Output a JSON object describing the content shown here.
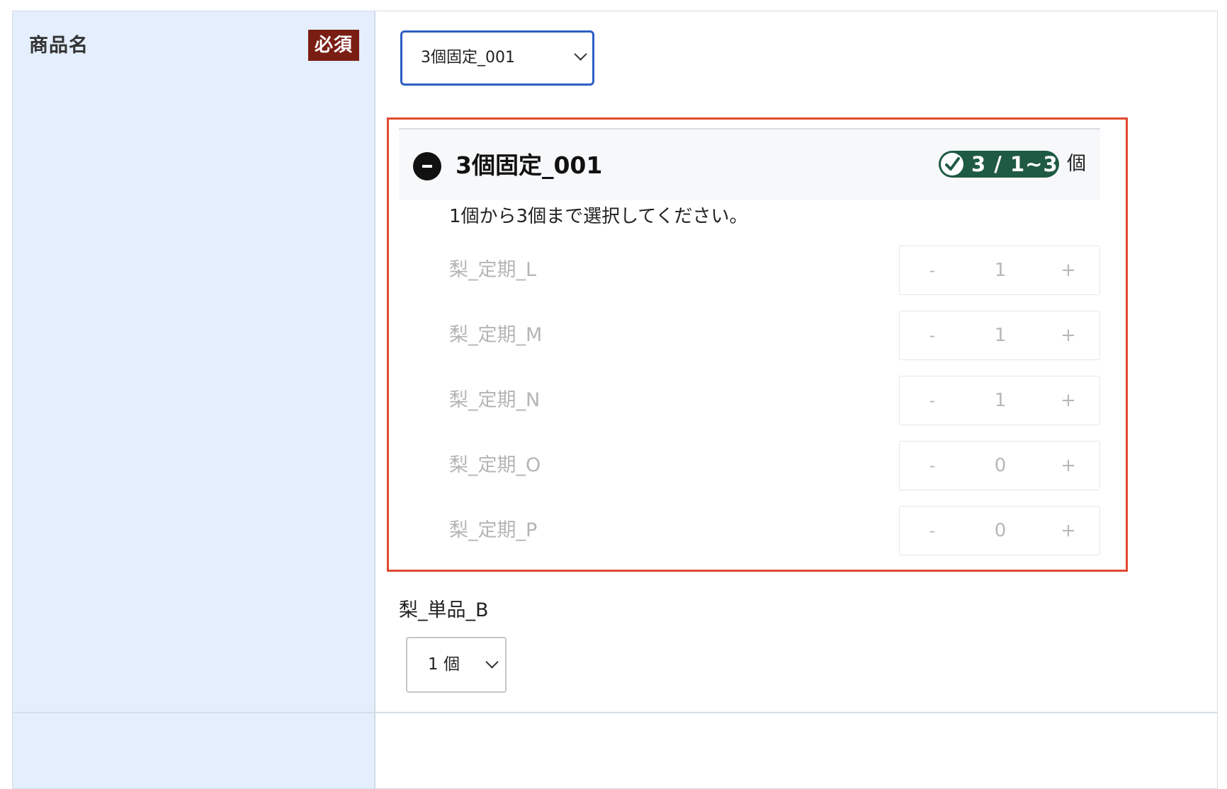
{
  "field": {
    "label": "商品名",
    "required_badge": "必須"
  },
  "product_select": {
    "selected": "3個固定_001"
  },
  "group": {
    "title": "3個固定_001",
    "count_badge": "3 / 1~3",
    "unit": "個",
    "instruction": "1個から3個まで選択してください。",
    "items": [
      {
        "name": "梨_定期_L",
        "quantity": "1",
        "minus": "-",
        "plus": "+"
      },
      {
        "name": "梨_定期_M",
        "quantity": "1",
        "minus": "-",
        "plus": "+"
      },
      {
        "name": "梨_定期_N",
        "quantity": "1",
        "minus": "-",
        "plus": "+"
      },
      {
        "name": "梨_定期_O",
        "quantity": "0",
        "minus": "-",
        "plus": "+"
      },
      {
        "name": "梨_定期_P",
        "quantity": "0",
        "minus": "-",
        "plus": "+"
      }
    ]
  },
  "single_item": {
    "name": "梨_単品_B",
    "quantity_selected": "1 個"
  },
  "colors": {
    "label_column_bg": "#e4eefc",
    "required_badge_bg": "#7a1e14",
    "select_focus_border": "#2d5fc4",
    "highlight_border": "#e04a2f",
    "count_badge_bg": "#1f5a43",
    "disabled_text": "#b5b5b5"
  },
  "icons": {
    "collapse": "minus-circle-icon",
    "count_check": "check-circle-icon",
    "select_arrow": "chevron-down-icon"
  }
}
